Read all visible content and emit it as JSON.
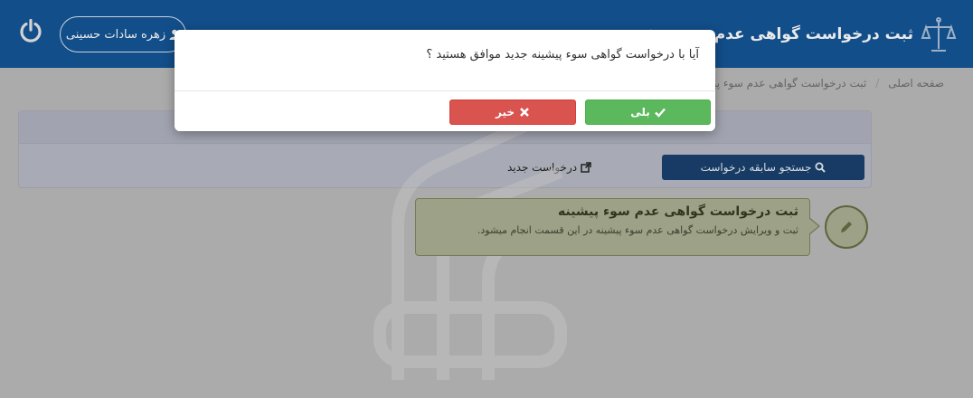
{
  "header": {
    "title": "ثبت درخواست گواهی عدم سوء پیشینه",
    "user_name": "زهره سادات حسینی",
    "logo_icon": "scales-of-justice-icon",
    "user_icon": "user-icon",
    "logout_icon": "power-icon"
  },
  "breadcrumb": {
    "home": "صفحه اصلی",
    "separator": "/",
    "current": "ثبت درخواست گواهی عدم سوء پیشینه"
  },
  "panel": {
    "search_button": "جستجو سابقه درخواست",
    "new_request": "درخواست جدید",
    "search_icon": "search-icon",
    "new_icon": "external-link-icon"
  },
  "info_card": {
    "title": "ثبت درخواست گواهی عدم سوء پیشینه",
    "description": "ثبت و ویرایش درخواست گواهی عدم سوء پیشینه در این قسمت انجام میشود.",
    "step_icon": "pencil-icon"
  },
  "modal": {
    "message": "آیا با درخواست گواهی سوء پیشینه جدید موافق هستید ؟",
    "confirm_label": "بلی",
    "cancel_label": "خیر",
    "confirm_icon": "check-icon",
    "cancel_icon": "times-icon"
  },
  "colors": {
    "header_bg": "#0b4f93",
    "confirm": "#5cb85c",
    "cancel": "#d9534f",
    "search_button": "#113968"
  }
}
